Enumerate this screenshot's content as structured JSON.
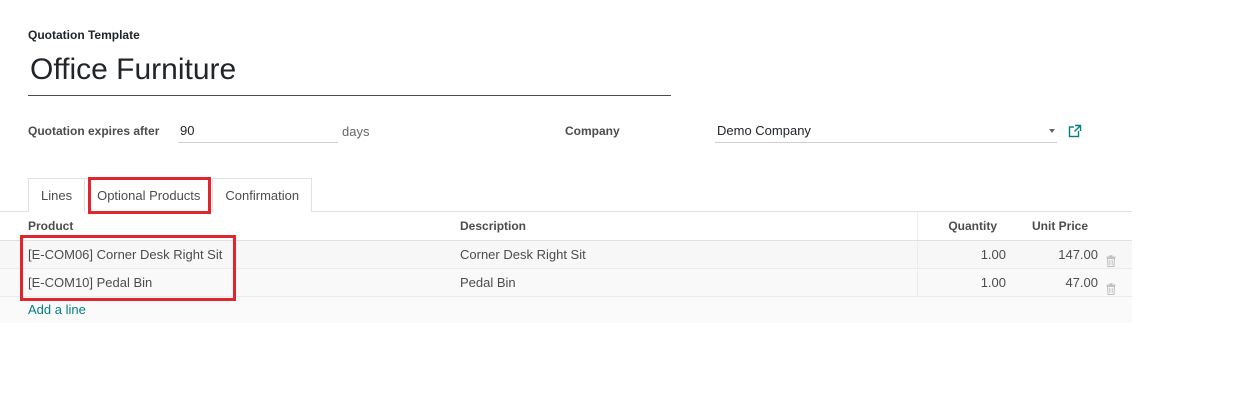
{
  "form": {
    "template_label": "Quotation Template",
    "template_name": "Office Furniture",
    "expires_label": "Quotation expires after",
    "expires_value": "90",
    "expires_unit": "days",
    "company_label": "Company",
    "company_value": "Demo Company"
  },
  "tabs": [
    {
      "label": "Lines"
    },
    {
      "label": "Optional Products",
      "active": true
    },
    {
      "label": "Confirmation"
    }
  ],
  "table": {
    "headers": {
      "product": "Product",
      "description": "Description",
      "quantity": "Quantity",
      "unit_price": "Unit Price"
    },
    "rows": [
      {
        "product": "[E-COM06] Corner Desk Right Sit",
        "description": "Corner Desk Right Sit",
        "quantity": "1.00",
        "unit_price": "147.00"
      },
      {
        "product": "[E-COM10] Pedal Bin",
        "description": "Pedal Bin",
        "quantity": "1.00",
        "unit_price": "47.00"
      }
    ],
    "add_line": "Add a line"
  },
  "colors": {
    "highlight": "#e0262c",
    "link": "#017e84"
  },
  "icons": {
    "company_link": "external-link-icon",
    "row_delete": "trash-icon",
    "select_caret": "caret-down-icon"
  }
}
